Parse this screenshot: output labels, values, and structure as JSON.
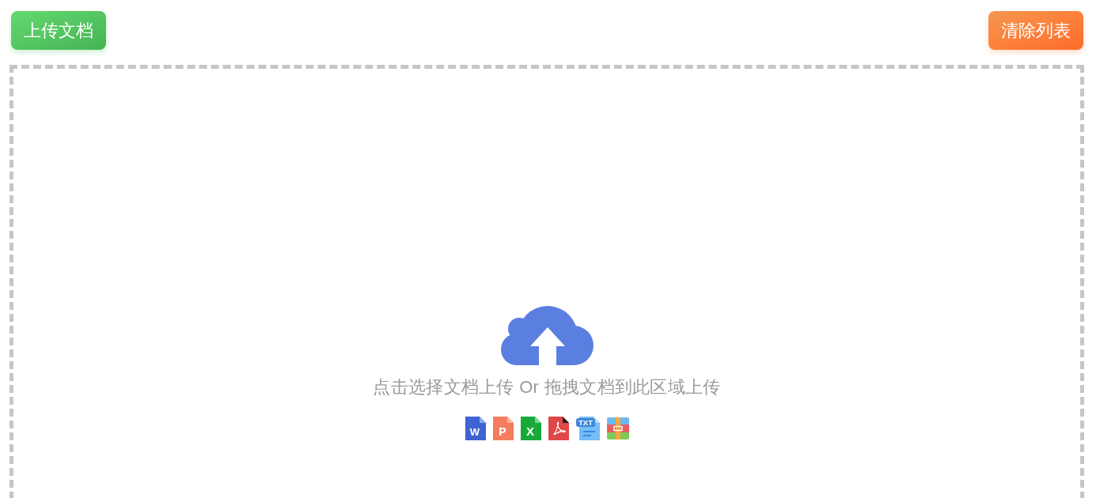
{
  "toolbar": {
    "upload_button": "上传文档",
    "clear_button": "清除列表"
  },
  "dropzone": {
    "hint": "点击选择文档上传 Or 拖拽文档到此区域上传",
    "file_types": [
      {
        "kind": "word",
        "glyph": "W"
      },
      {
        "kind": "powerpoint",
        "glyph": "P"
      },
      {
        "kind": "excel",
        "glyph": "X"
      },
      {
        "kind": "pdf"
      },
      {
        "kind": "text",
        "glyph": "TXT"
      },
      {
        "kind": "archive"
      }
    ]
  }
}
